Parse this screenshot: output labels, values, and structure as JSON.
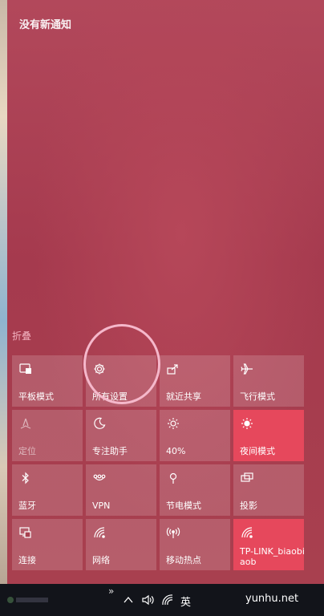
{
  "notifications": {
    "empty_text": "没有新通知"
  },
  "collapse_label": "折叠",
  "tiles": [
    {
      "label": "平板模式",
      "icon": "tablet-mode-icon",
      "state": "off"
    },
    {
      "label": "所有设置",
      "icon": "gear-icon",
      "state": "off"
    },
    {
      "label": "就近共享",
      "icon": "nearby-share-icon",
      "state": "off"
    },
    {
      "label": "飞行模式",
      "icon": "airplane-icon",
      "state": "off"
    },
    {
      "label": "定位",
      "icon": "location-icon",
      "state": "disabled"
    },
    {
      "label": "专注助手",
      "icon": "moon-icon",
      "state": "off"
    },
    {
      "label": "40%",
      "icon": "brightness-icon",
      "state": "off"
    },
    {
      "label": "夜间模式",
      "icon": "night-light-icon",
      "state": "on"
    },
    {
      "label": "蓝牙",
      "icon": "bluetooth-icon",
      "state": "off"
    },
    {
      "label": "VPN",
      "icon": "vpn-icon",
      "state": "off"
    },
    {
      "label": "节电模式",
      "icon": "battery-saver-icon",
      "state": "off"
    },
    {
      "label": "投影",
      "icon": "project-icon",
      "state": "off"
    },
    {
      "label": "连接",
      "icon": "connect-icon",
      "state": "off"
    },
    {
      "label": "网络",
      "icon": "network-icon",
      "state": "off"
    },
    {
      "label": "移动热点",
      "icon": "hotspot-icon",
      "state": "off"
    },
    {
      "label": "TP-LINK_biaobiaob",
      "icon": "wifi-icon",
      "state": "on"
    }
  ],
  "taskbar": {
    "chevron": "»",
    "ime_label": "英",
    "watermark": "yunhu.net"
  },
  "colors": {
    "accent": "#e6485c",
    "panel": "#a83a4e",
    "ring": "#f5b8cb"
  }
}
